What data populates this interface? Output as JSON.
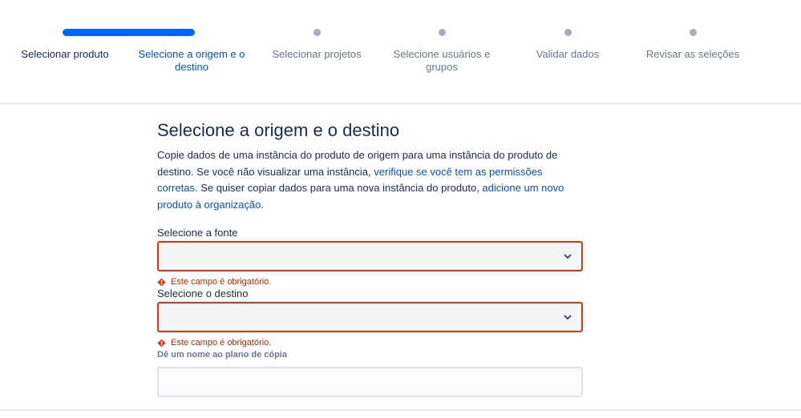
{
  "colors": {
    "accent": "#0052cc",
    "progress": "#0065ff",
    "error": "#de350b",
    "text": "#172b4d",
    "muted": "#6b778c",
    "inactive_dot": "#a5adba"
  },
  "stepper": {
    "steps": [
      {
        "label": "Selecionar produto",
        "state": "done"
      },
      {
        "label": "Selecione a origem e o destino",
        "state": "active"
      },
      {
        "label": "Selecionar projetos",
        "state": "pending"
      },
      {
        "label": "Selecione usuários e grupos",
        "state": "pending"
      },
      {
        "label": "Validar dados",
        "state": "pending"
      },
      {
        "label": "Revisar as seleções",
        "state": "pending"
      }
    ]
  },
  "page": {
    "title": "Selecione a origem e o destino",
    "description": {
      "part1": "Copie dados de uma instância do produto de origem para uma instância do produto de destino. Se você não visualizar uma instância, ",
      "link1": "verifique se você tem as permissões corretas",
      "part2": ". Se quiser copiar dados para uma nova instância do produto, ",
      "link2": "adicione um novo produto à organização",
      "part3": "."
    }
  },
  "form": {
    "source": {
      "label": "Selecione a fonte",
      "value": "",
      "error": "Este campo é obrigatório.",
      "icon": "chevron-down-icon"
    },
    "destination": {
      "label": "Selecione o destino",
      "value": "",
      "error": "Este campo é obrigatório.",
      "icon": "chevron-down-icon"
    },
    "plan_name": {
      "label": "Dê um nome ao plano de cópia",
      "value": "",
      "placeholder": ""
    }
  }
}
